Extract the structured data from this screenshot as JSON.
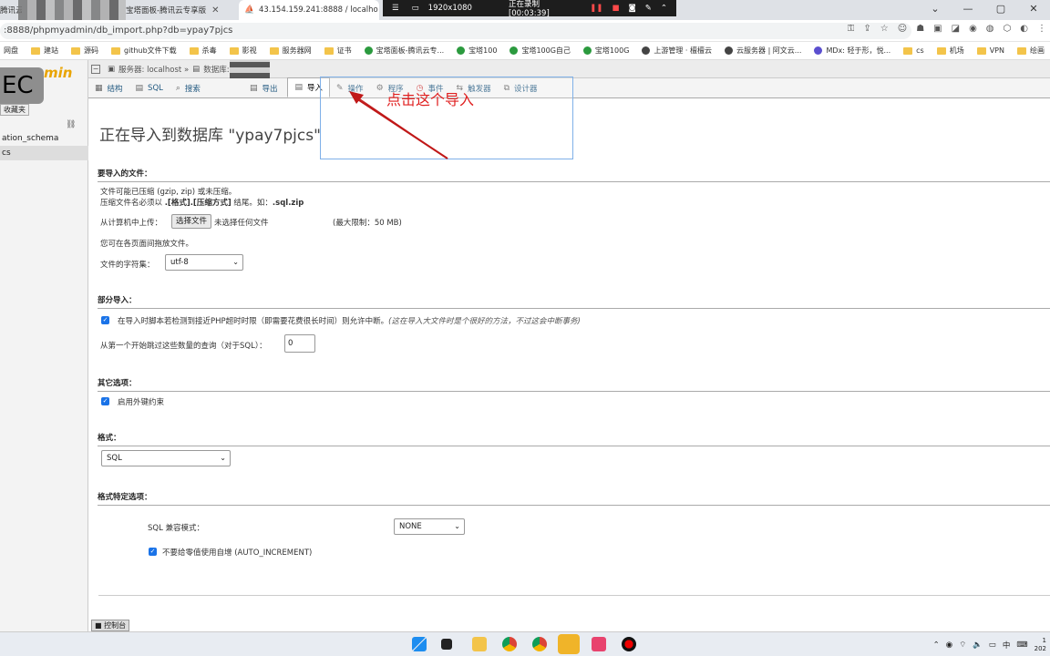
{
  "browser": {
    "tabs": [
      {
        "label": "腾讯云"
      },
      {
        "label": "宝塔面板-腾讯云专享版"
      },
      {
        "label": "43.154.159.241:8888 / localho"
      }
    ],
    "recorder": {
      "resolution": "1920x1080",
      "status": "正在录制 [00:03:39]"
    },
    "url": ":8888/phpmyadmin/db_import.php?db=ypay7pjcs"
  },
  "bookmarks": [
    {
      "label": "网盘",
      "kind": "folder"
    },
    {
      "label": "建站",
      "kind": "folder"
    },
    {
      "label": "源码",
      "kind": "folder"
    },
    {
      "label": "github文件下载",
      "kind": "folder"
    },
    {
      "label": "杀毒",
      "kind": "folder"
    },
    {
      "label": "影视",
      "kind": "folder"
    },
    {
      "label": "服务器网",
      "kind": "folder"
    },
    {
      "label": "证书",
      "kind": "folder"
    },
    {
      "label": "宝塔面板-腾讯云专...",
      "kind": "shield"
    },
    {
      "label": "宝塔100",
      "kind": "shield"
    },
    {
      "label": "宝塔100G自己",
      "kind": "shield"
    },
    {
      "label": "宝塔100G",
      "kind": "shield"
    },
    {
      "label": "上游管理 · 檀檀云",
      "kind": "globe"
    },
    {
      "label": "云服务器 | 阿文云...",
      "kind": "globe"
    },
    {
      "label": "MDx: 轻于形，悦...",
      "kind": "globe"
    },
    {
      "label": "cs",
      "kind": "folder"
    },
    {
      "label": "机场",
      "kind": "folder"
    },
    {
      "label": "VPN",
      "kind": "folder"
    },
    {
      "label": "绘画",
      "kind": "folder"
    }
  ],
  "sidebar": {
    "logo": "min",
    "badge": "EC",
    "favorites": "收藏夹",
    "databases": [
      {
        "label": "ation_schema",
        "selected": false
      },
      {
        "label": "cs",
        "selected": true
      }
    ]
  },
  "breadcrumb": {
    "server": "服务器: localhost »",
    "database": "数据库:"
  },
  "menu_tabs": [
    {
      "label": "结构",
      "icon": "▦",
      "active": false
    },
    {
      "label": "SQL",
      "icon": "▤",
      "active": false
    },
    {
      "label": "搜索",
      "icon": "🔍",
      "active": false
    },
    {
      "label": "导出",
      "icon": "▤",
      "active": false
    },
    {
      "label": "导入",
      "icon": "▤",
      "active": true
    },
    {
      "label": "操作",
      "icon": "✎",
      "active": false
    },
    {
      "label": "程序",
      "icon": "⚙",
      "active": false
    },
    {
      "label": "事件",
      "icon": "◷",
      "active": false
    },
    {
      "label": "触发器",
      "icon": "⇆",
      "active": false
    },
    {
      "label": "设计器",
      "icon": "⧉",
      "active": false
    }
  ],
  "annotation": "点击这个导入",
  "page_title": "正在导入到数据库 \"ypay7pjcs\"",
  "file_section": {
    "heading": "要导入的文件：",
    "line1": "文件可能已压缩 (gzip, zip) 或未压缩。",
    "line2_prefix": "压缩文件名必须以 ",
    "line2_bold": ".[格式].[压缩方式]",
    "line2_mid": " 结尾。如：",
    "line2_example": ".sql.zip",
    "upload_label": "从计算机中上传：",
    "choose_button": "选择文件",
    "no_file": "未选择任何文件",
    "max_size": "(最大限制：50 MB)",
    "drag_hint": "您可在各页面间拖放文件。",
    "charset_label": "文件的字符集：",
    "charset_value": "utf-8"
  },
  "partial_section": {
    "heading": "部分导入：",
    "allow_interrupt": "在导入时脚本若检测到接近PHP超时时限（即需要花费很长时间）则允许中断。",
    "allow_interrupt_note": "(这在导入大文件时是个很好的方法，不过这会中断事务)",
    "allow_interrupt_checked": true,
    "skip_label": "从第一个开始跳过这些数量的查询（对于SQL）：",
    "skip_value": "0"
  },
  "other_section": {
    "heading": "其它选项：",
    "fk_label": "启用外键约束",
    "fk_checked": true
  },
  "format_section": {
    "heading": "格式：",
    "format_value": "SQL"
  },
  "format_options_section": {
    "heading": "格式特定选项：",
    "compat_label": "SQL 兼容模式：",
    "compat_value": "NONE",
    "auto_inc_label": "不要给零值使用自增 (AUTO_INCREMENT)",
    "auto_inc_checked": true
  },
  "console_label": "控制台",
  "tray": {
    "ime": "中",
    "time": "1",
    "date": "202"
  }
}
